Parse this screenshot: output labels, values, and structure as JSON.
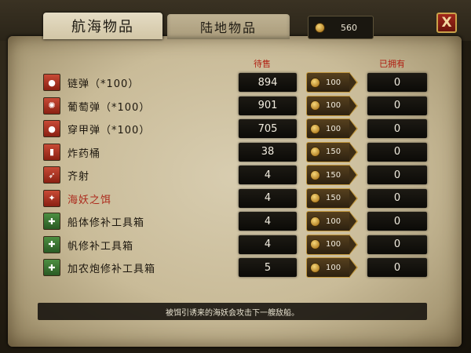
{
  "tabs": [
    {
      "label": "航海物品",
      "active": true
    },
    {
      "label": "陆地物品",
      "active": false
    }
  ],
  "gold": {
    "value": "560",
    "icon": "coin-icon"
  },
  "close": {
    "label": "X"
  },
  "columns": {
    "stock": "待售",
    "owned": "已拥有"
  },
  "items": [
    {
      "name": "链弹（*100）",
      "icon": "chain-shot-icon",
      "stock": "894",
      "price": "100",
      "owned": "0",
      "highlight": false
    },
    {
      "name": "葡萄弹（*100）",
      "icon": "grape-shot-icon",
      "stock": "901",
      "price": "100",
      "owned": "0",
      "highlight": false
    },
    {
      "name": "穿甲弹（*100）",
      "icon": "armor-piercing-shot-icon",
      "stock": "705",
      "price": "100",
      "owned": "0",
      "highlight": false
    },
    {
      "name": "炸药桶",
      "icon": "powder-keg-icon",
      "stock": "38",
      "price": "150",
      "owned": "0",
      "highlight": false
    },
    {
      "name": "齐射",
      "icon": "broadside-icon",
      "stock": "4",
      "price": "150",
      "owned": "0",
      "highlight": false
    },
    {
      "name": "海妖之饵",
      "icon": "kraken-bait-icon",
      "stock": "4",
      "price": "150",
      "owned": "0",
      "highlight": true
    },
    {
      "name": "船体修补工具箱",
      "icon": "hull-repair-kit-icon",
      "stock": "4",
      "price": "100",
      "owned": "0",
      "highlight": false
    },
    {
      "name": "帆修补工具箱",
      "icon": "sail-repair-kit-icon",
      "stock": "4",
      "price": "100",
      "owned": "0",
      "highlight": false
    },
    {
      "name": "加农炮修补工具箱",
      "icon": "cannon-repair-kit-icon",
      "stock": "5",
      "price": "100",
      "owned": "0",
      "highlight": false
    }
  ],
  "tooltip": "被饵引诱来的海妖会攻击下一艘敌船。",
  "colors": {
    "parchment": "#c9bb98",
    "header_red": "#b01e12",
    "highlight_red": "#ac2a1c",
    "button_gold": "#c2983e"
  }
}
